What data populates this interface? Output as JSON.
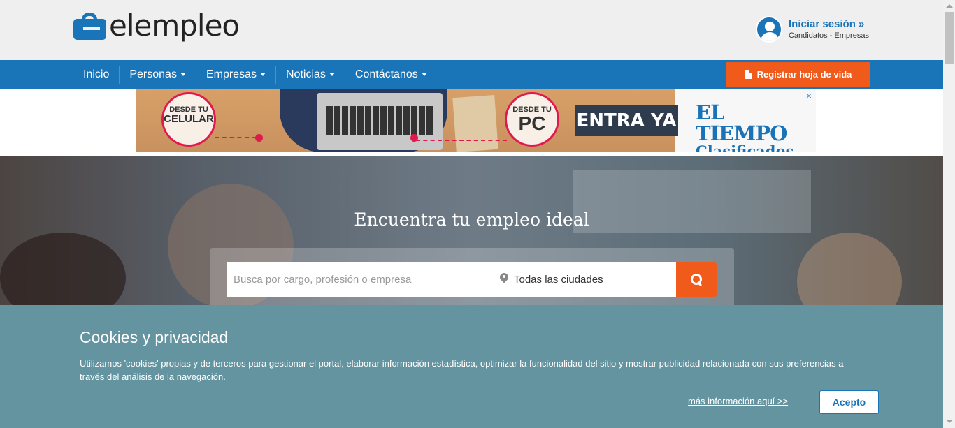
{
  "header": {
    "logo_text": "elempleo",
    "login_label": "Iniciar sesión »",
    "login_sub": "Candidatos - Empresas"
  },
  "nav": {
    "items": [
      {
        "label": "Inicio"
      },
      {
        "label": "Personas"
      },
      {
        "label": "Empresas"
      },
      {
        "label": "Noticias"
      },
      {
        "label": "Contáctanos"
      }
    ],
    "register_label": "Registrar hoja de vida"
  },
  "ad": {
    "circle1_small": "DESDE TU",
    "circle1_big": "CELULAR",
    "circle2_small": "DESDE TU",
    "circle2_big": "PC",
    "cta": "ENTRA YA",
    "brand_line1": "EL TIEMPO",
    "brand_line2": "Clasificados",
    "close": "×"
  },
  "hero": {
    "title": "Encuentra tu empleo ideal",
    "search_placeholder": "Busca por cargo, profesión o empresa",
    "city_value": "Todas las ciudades"
  },
  "cookies": {
    "title": "Cookies y privacidad",
    "text": "Utilizamos 'cookies' propias y de terceros para gestionar el portal, elaborar información estadística, optimizar la funcionalidad del sitio y mostrar publicidad relacionada con sus preferencias a través del análisis de la navegación.",
    "more_link": "más información aquí >>",
    "accept_label": "Acepto"
  },
  "colors": {
    "brand_blue": "#1a74b8",
    "accent_orange": "#f05a1a",
    "cookie_bg": "#6394a0"
  }
}
